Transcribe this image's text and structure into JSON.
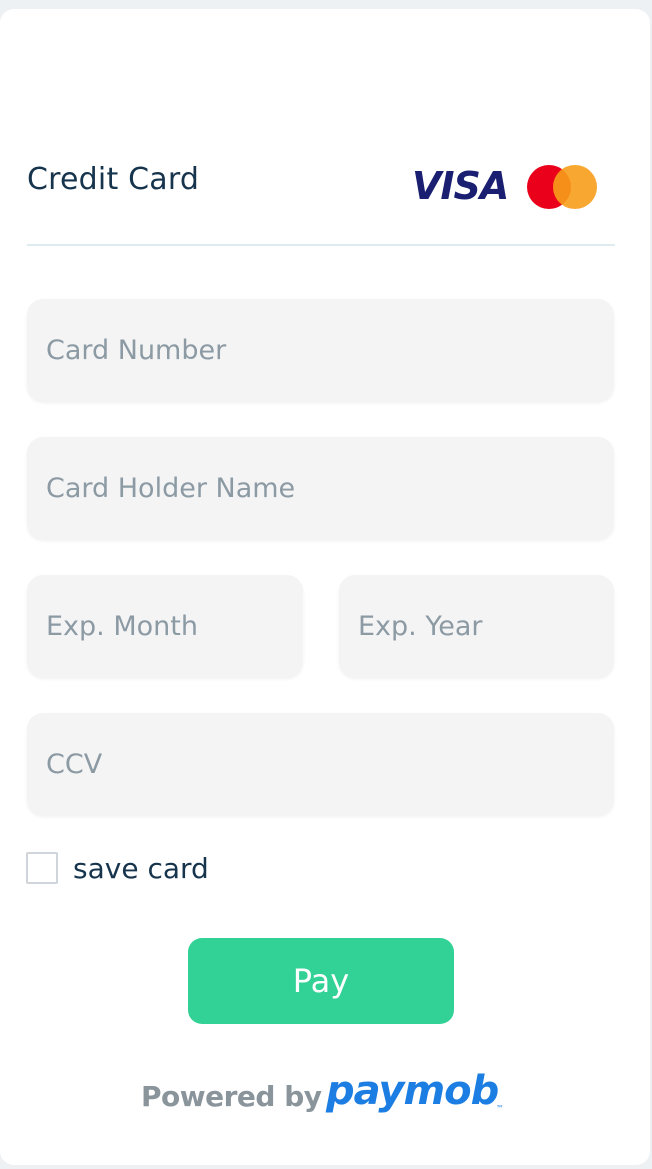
{
  "header": {
    "title": "Credit Card",
    "visa_logo_text": "VISA",
    "mastercard_logo": "mastercard-icon"
  },
  "form": {
    "card_number_placeholder": "Card Number",
    "card_holder_placeholder": "Card Holder Name",
    "exp_month_placeholder": "Exp. Month",
    "exp_year_placeholder": "Exp. Year",
    "ccv_placeholder": "CCV",
    "save_card_label": "save card",
    "save_card_checked": false
  },
  "actions": {
    "pay_label": "Pay"
  },
  "footer": {
    "powered_by": "Powered by",
    "brand": "paymob"
  },
  "colors": {
    "accent": "#32d195",
    "title": "#17344d",
    "brand_blue": "#1c7de2",
    "field_bg": "#f4f4f5"
  }
}
